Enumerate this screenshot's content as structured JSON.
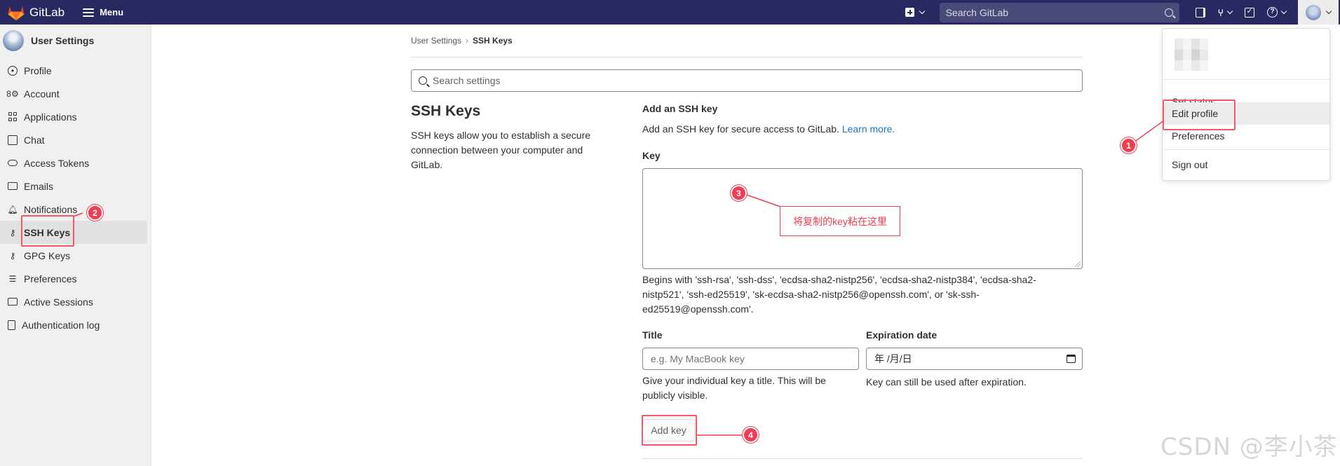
{
  "navbar": {
    "brand": "GitLab",
    "menu_label": "Menu",
    "search_placeholder": "Search GitLab",
    "colors": {
      "bg": "#292961",
      "logo_orange": "#e24329"
    }
  },
  "sidebar": {
    "title": "User Settings",
    "items": [
      {
        "label": "Profile",
        "icon": "user-icon"
      },
      {
        "label": "Account",
        "icon": "account-icon"
      },
      {
        "label": "Applications",
        "icon": "applications-icon"
      },
      {
        "label": "Chat",
        "icon": "chat-icon"
      },
      {
        "label": "Access Tokens",
        "icon": "token-icon"
      },
      {
        "label": "Emails",
        "icon": "mail-icon"
      },
      {
        "label": "Notifications",
        "icon": "bell-icon"
      },
      {
        "label": "SSH Keys",
        "icon": "key-icon",
        "active": true
      },
      {
        "label": "GPG Keys",
        "icon": "key-icon"
      },
      {
        "label": "Preferences",
        "icon": "preferences-icon"
      },
      {
        "label": "Active Sessions",
        "icon": "monitor-icon"
      },
      {
        "label": "Authentication log",
        "icon": "log-icon"
      }
    ]
  },
  "breadcrumb": {
    "parent": "User Settings",
    "current": "SSH Keys"
  },
  "search_settings": {
    "placeholder": "Search settings"
  },
  "section": {
    "title": "SSH Keys",
    "description": "SSH keys allow you to establish a secure connection between your computer and GitLab."
  },
  "form": {
    "heading": "Add an SSH key",
    "description": "Add an SSH key for secure access to GitLab.",
    "learn_more": "Learn more.",
    "key_label": "Key",
    "key_help": "Begins with 'ssh-rsa', 'ssh-dss', 'ecdsa-sha2-nistp256', 'ecdsa-sha2-nistp384', 'ecdsa-sha2-nistp521', 'ssh-ed25519', 'sk-ecdsa-sha2-nistp256@openssh.com', or 'sk-ssh-ed25519@openssh.com'.",
    "title_label": "Title",
    "title_placeholder": "e.g. My MacBook key",
    "title_help": "Give your individual key a title. This will be publicly visible.",
    "expiration_label": "Expiration date",
    "expiration_value": "年 /月/日",
    "expiration_help": "Key can still be used after expiration.",
    "submit_label": "Add key",
    "link_color": "#1f75cb"
  },
  "user_dropdown": {
    "items": [
      {
        "label": "Set status"
      },
      {
        "label": "Edit profile",
        "highlighted": true
      },
      {
        "label": "Preferences"
      },
      {
        "label": "Sign out"
      }
    ]
  },
  "annotations": {
    "color": "#f03d52",
    "badges": [
      "1",
      "2",
      "3",
      "4"
    ],
    "callout_text": "将复制的key粘在这里"
  },
  "watermark": "CSDN @李小茶"
}
